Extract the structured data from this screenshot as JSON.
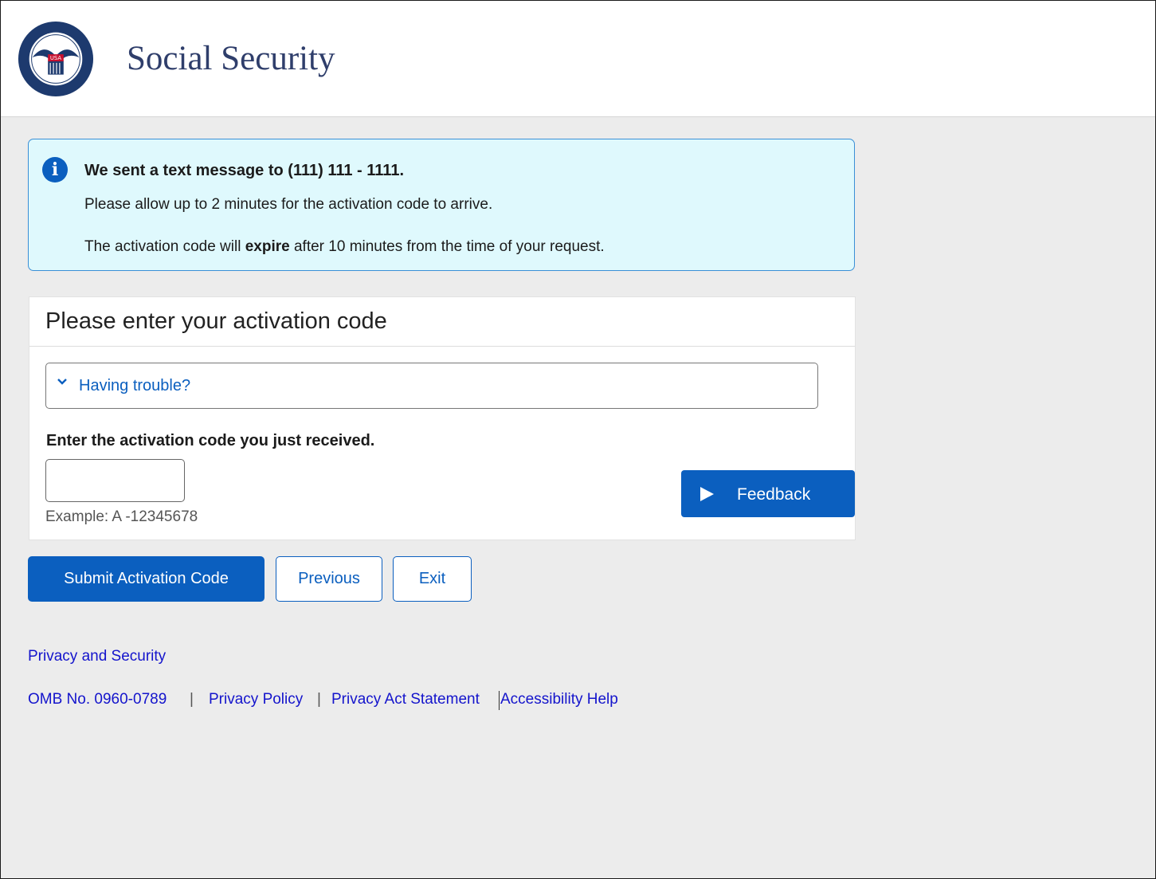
{
  "header": {
    "brand": "Social Security",
    "seal_text": "USA"
  },
  "alert": {
    "icon": "info-icon",
    "title": "We sent a text message to (111) 111 - 1111.",
    "line1": "Please allow up to 2 minutes for the activation code to arrive.",
    "line2_before": "The activation code will ",
    "line2_bold": "expire",
    "line2_after": " after 10 minutes from the time of your request."
  },
  "card": {
    "title": "Please enter your activation code",
    "trouble_label": "Having trouble?",
    "enter_label": "Enter the activation code you just received.",
    "input_value": "",
    "example": "Example: A -12345678",
    "feedback_label": "Feedback"
  },
  "buttons": {
    "submit": "Submit Activation Code",
    "previous": "Previous",
    "exit": "Exit"
  },
  "footer": {
    "privacy_security": "Privacy and Security",
    "omb": "OMB No. 0960-0789",
    "sep": "|",
    "privacy_policy": "Privacy Policy",
    "privacy_act": "Privacy Act Statement",
    "accessibility": "Accessibility Help"
  },
  "colors": {
    "primary": "#0b5fbf",
    "alert_bg": "#dff9fd",
    "brand_text": "#2f3e6b",
    "link": "#1414cc"
  }
}
